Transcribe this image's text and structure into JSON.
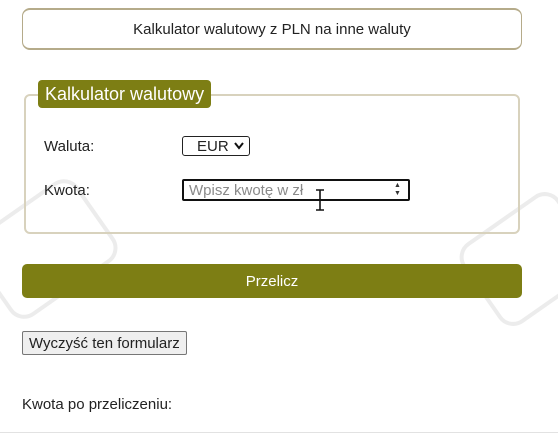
{
  "header": {
    "title": "Kalkulator walutowy z PLN na inne waluty"
  },
  "calculator": {
    "legend": "Kalkulator walutowy",
    "currency_label": "Waluta:",
    "currency_selected": "EUR",
    "amount_label": "Kwota:",
    "amount_placeholder": "Wpisz kwotę w zł",
    "amount_value": ""
  },
  "buttons": {
    "convert": "Przelicz",
    "reset": "Wyczyść ten formularz"
  },
  "result": {
    "label": "Kwota po przeliczeniu:"
  },
  "colors": {
    "accent": "#7d7e14",
    "border_beige": "#d8d2bd"
  },
  "icons": [
    "chevron-down-icon",
    "spinner-up-icon",
    "spinner-down-icon",
    "text-cursor-icon"
  ]
}
